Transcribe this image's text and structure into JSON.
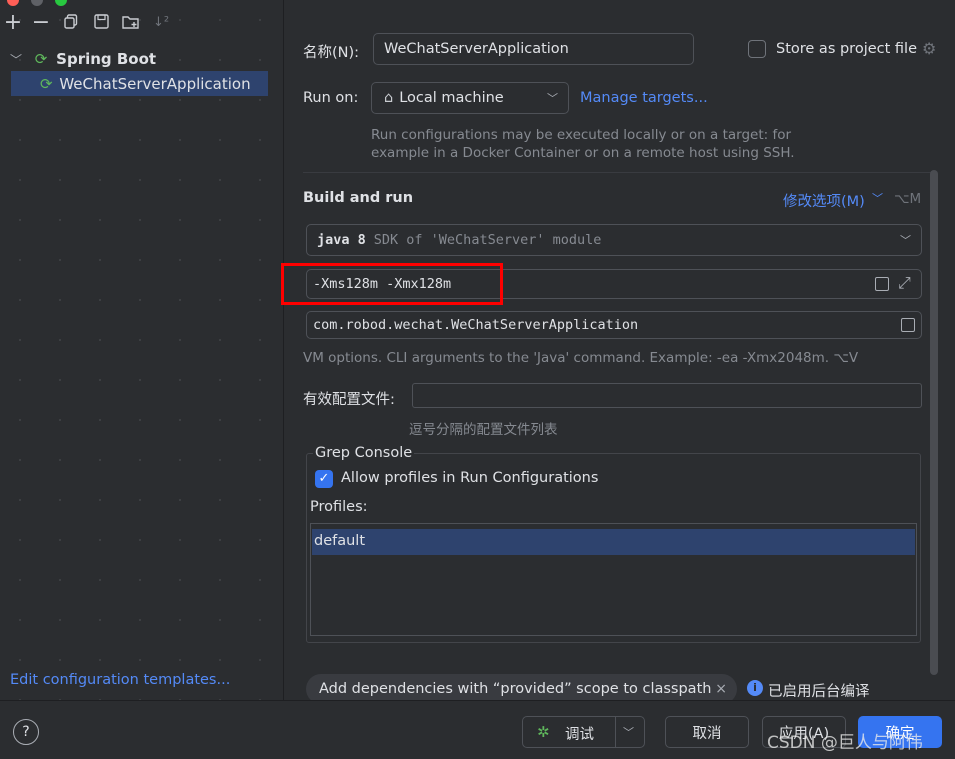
{
  "toolbar": {
    "icons": [
      "add-icon",
      "remove-icon",
      "copy-icon",
      "save-icon",
      "new-folder-icon",
      "sort-icon"
    ]
  },
  "tree": {
    "group_label": "Spring Boot",
    "item_label": "WeChatServerApplication"
  },
  "left_footer": {
    "templates_link": "Edit configuration templates..."
  },
  "form": {
    "name_label": "名称(N):",
    "name_value": "WeChatServerApplication",
    "store_project_file_label": "Store as project file",
    "store_project_file_checked": false,
    "run_on_label": "Run on:",
    "run_on_value": "Local machine",
    "manage_targets_link": "Manage targets...",
    "run_on_hint_line1": "Run configurations may be executed locally or on a target: for",
    "run_on_hint_line2": "example in a Docker Container or on a remote host using SSH.",
    "build_run_title": "Build and run",
    "modify_options_link": "修改选项(M)",
    "modify_options_shortcut": "⌥M",
    "jdk_version": "java 8",
    "jdk_detail": "SDK of 'WeChatServer' module",
    "vm_options_value": "-Xms128m -Xmx128m",
    "main_class_value": "com.robod.wechat.WeChatServerApplication",
    "vm_hint": "VM options. CLI arguments to the 'Java' command. Example: -ea -Xmx2048m. ⌥V",
    "profiles_label": "有效配置文件:",
    "profiles_value": "",
    "profiles_hint": "逗号分隔的配置文件列表"
  },
  "grep_console": {
    "title": "Grep Console",
    "allow_profiles_label": "Allow profiles in Run Configurations",
    "allow_profiles_checked": true,
    "profiles_label": "Profiles:",
    "profiles_items": [
      "default"
    ]
  },
  "footer": {
    "dependency_chip": "Add dependencies with “provided” scope to classpath",
    "background_compile_label": "已启用后台编译",
    "help_label": "?",
    "debug_button": "调试",
    "cancel_button": "取消",
    "apply_button": "应用(A)",
    "ok_button": "确定",
    "watermark": "CSDN @巨人与阿伟"
  },
  "colors": {
    "accent": "#548af7",
    "primary_button": "#3574f0",
    "selection": "#2e436e",
    "highlight_box": "#ff0000"
  }
}
